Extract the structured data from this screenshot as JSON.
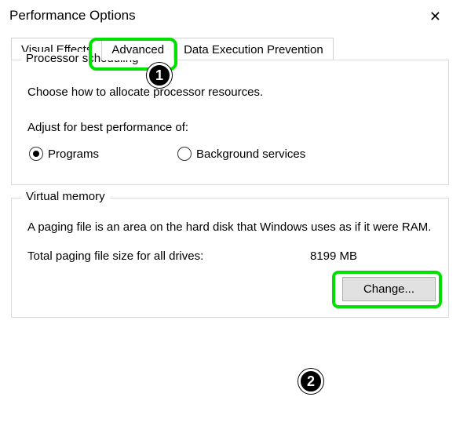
{
  "window": {
    "title": "Performance Options",
    "close_glyph": "✕"
  },
  "tabs": {
    "visual_effects": "Visual Effects",
    "advanced": "Advanced",
    "dep": "Data Execution Prevention"
  },
  "processor": {
    "group_label": "Processor scheduling",
    "description": "Choose how to allocate processor resources.",
    "adjust_label": "Adjust for best performance of:",
    "option_programs": "Programs",
    "option_background": "Background services",
    "selected": "programs"
  },
  "virtual_memory": {
    "group_label": "Virtual memory",
    "description": "A paging file is an area on the hard disk that Windows uses as if it were RAM.",
    "total_label": "Total paging file size for all drives:",
    "total_value": "8199 MB",
    "change_button": "Change..."
  },
  "annotations": {
    "one": "1",
    "two": "2"
  }
}
